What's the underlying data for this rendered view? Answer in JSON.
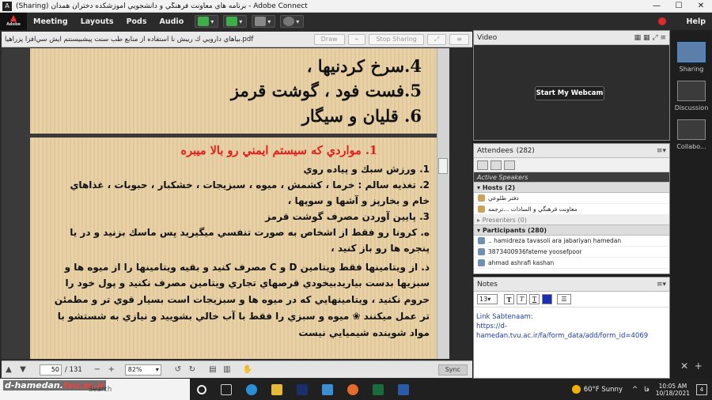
{
  "window": {
    "title": "(Sharing) برنامه هاي معاونت فرهنگي و دانشجويي آموزشكده دختران همدان - Adobe Connect",
    "min": "—",
    "max": "☐",
    "close": "✕"
  },
  "menu": {
    "logo": "Adobe",
    "items": [
      "Meeting",
      "Layouts",
      "Pods",
      "Audio"
    ],
    "help": "Help"
  },
  "share": {
    "filename": "بياهاي دارويي ك ريبش نا استفاده از منابع طب سنت پيشبيسنتم ايش سي‌افزا پزراهيا.pdf",
    "draw": "Draw",
    "stop": "Stop Sharing"
  },
  "doc": {
    "page1": [
      "4.سرخ كردنيها ،",
      "5.فست فود ، گوشت قرمز",
      "6. قليان و سيگار"
    ],
    "page2_title": "1. مواردي كه سيستم ايمني رو بالا ميبره",
    "page2": [
      "1. ورزش سبك و پياده روي",
      "2.  تغذيه سالم : خرما ، كشمش ، ميوه ، سبزيجات ، خشكبار ، حبوبات ، غذاهاي",
      "خام و بخارپز و آشها و سوپها ،",
      "3.  پايين آوردن مصرف گوشت قرمز",
      "ه.  كرونا رو فقط از اشخاص به صورت تنفسي ميگيريد  پس ماسك بزنيد و در يا",
      "پنجره ها رو باز كنيد ،",
      "ذ.  از ويتامينها فقط ويتامين  D و  C مصرف كنيد و بقيه ويتامينها را از ميوه ها و",
      "سبزيها بدست بياريدبيخودي قرصهاي تجاري ويتامين مصرف نكنيد  و پول خود را",
      "حروم نكنيد ، ويتامينهايي  كه در ميوه ها و سبزيجات است بسيار قوي تر و مطمئن",
      "تر عمل ميكنند ❀ ميوه و سبزي را فقط با آب خالي بشوييد و نيازي به شستشو با",
      "مواد شوينده شيميايي نيست"
    ]
  },
  "doctools": {
    "page": "50",
    "total": "/ 131",
    "zoom": "82%",
    "sync": "Sync"
  },
  "video": {
    "title": "Video",
    "webcam": "Start My Webcam"
  },
  "attendees": {
    "title": "Attendees",
    "count": "(282)",
    "active": "Active Speakers",
    "hosts": "Hosts (2)",
    "host_rows": [
      "دفتر طلوعي",
      "معاونت فرهنگي و السادات ...ترجمه"
    ],
    "presenters": "Presenters (0)",
    "participants": "Participants (280)",
    "part_rows": [
      ".. hamidreza tavasoli ara jabariyan hamedan",
      "3873400936fateme yoosefpoor",
      "ahmad ashrafi  kashan"
    ]
  },
  "notes": {
    "title": "Notes",
    "size": "13",
    "b": "T",
    "i": "T",
    "u": "T",
    "link_label": "Link Sabtenaam:",
    "link": "https://d-hamedan.tvu.ac.ir/fa/form_data/add/form_id=4069"
  },
  "layouts": [
    "Sharing",
    "Discussion",
    "Collabo..."
  ],
  "taskbar": {
    "search": "Search",
    "weather": "60°F  Sunny",
    "lang": "فا",
    "time": "10:05 AM",
    "date": "10/18/2021",
    "notif": "4"
  },
  "watermark": {
    "pre": "d-hamedan.",
    "brand": "tvu.ac.ir"
  }
}
